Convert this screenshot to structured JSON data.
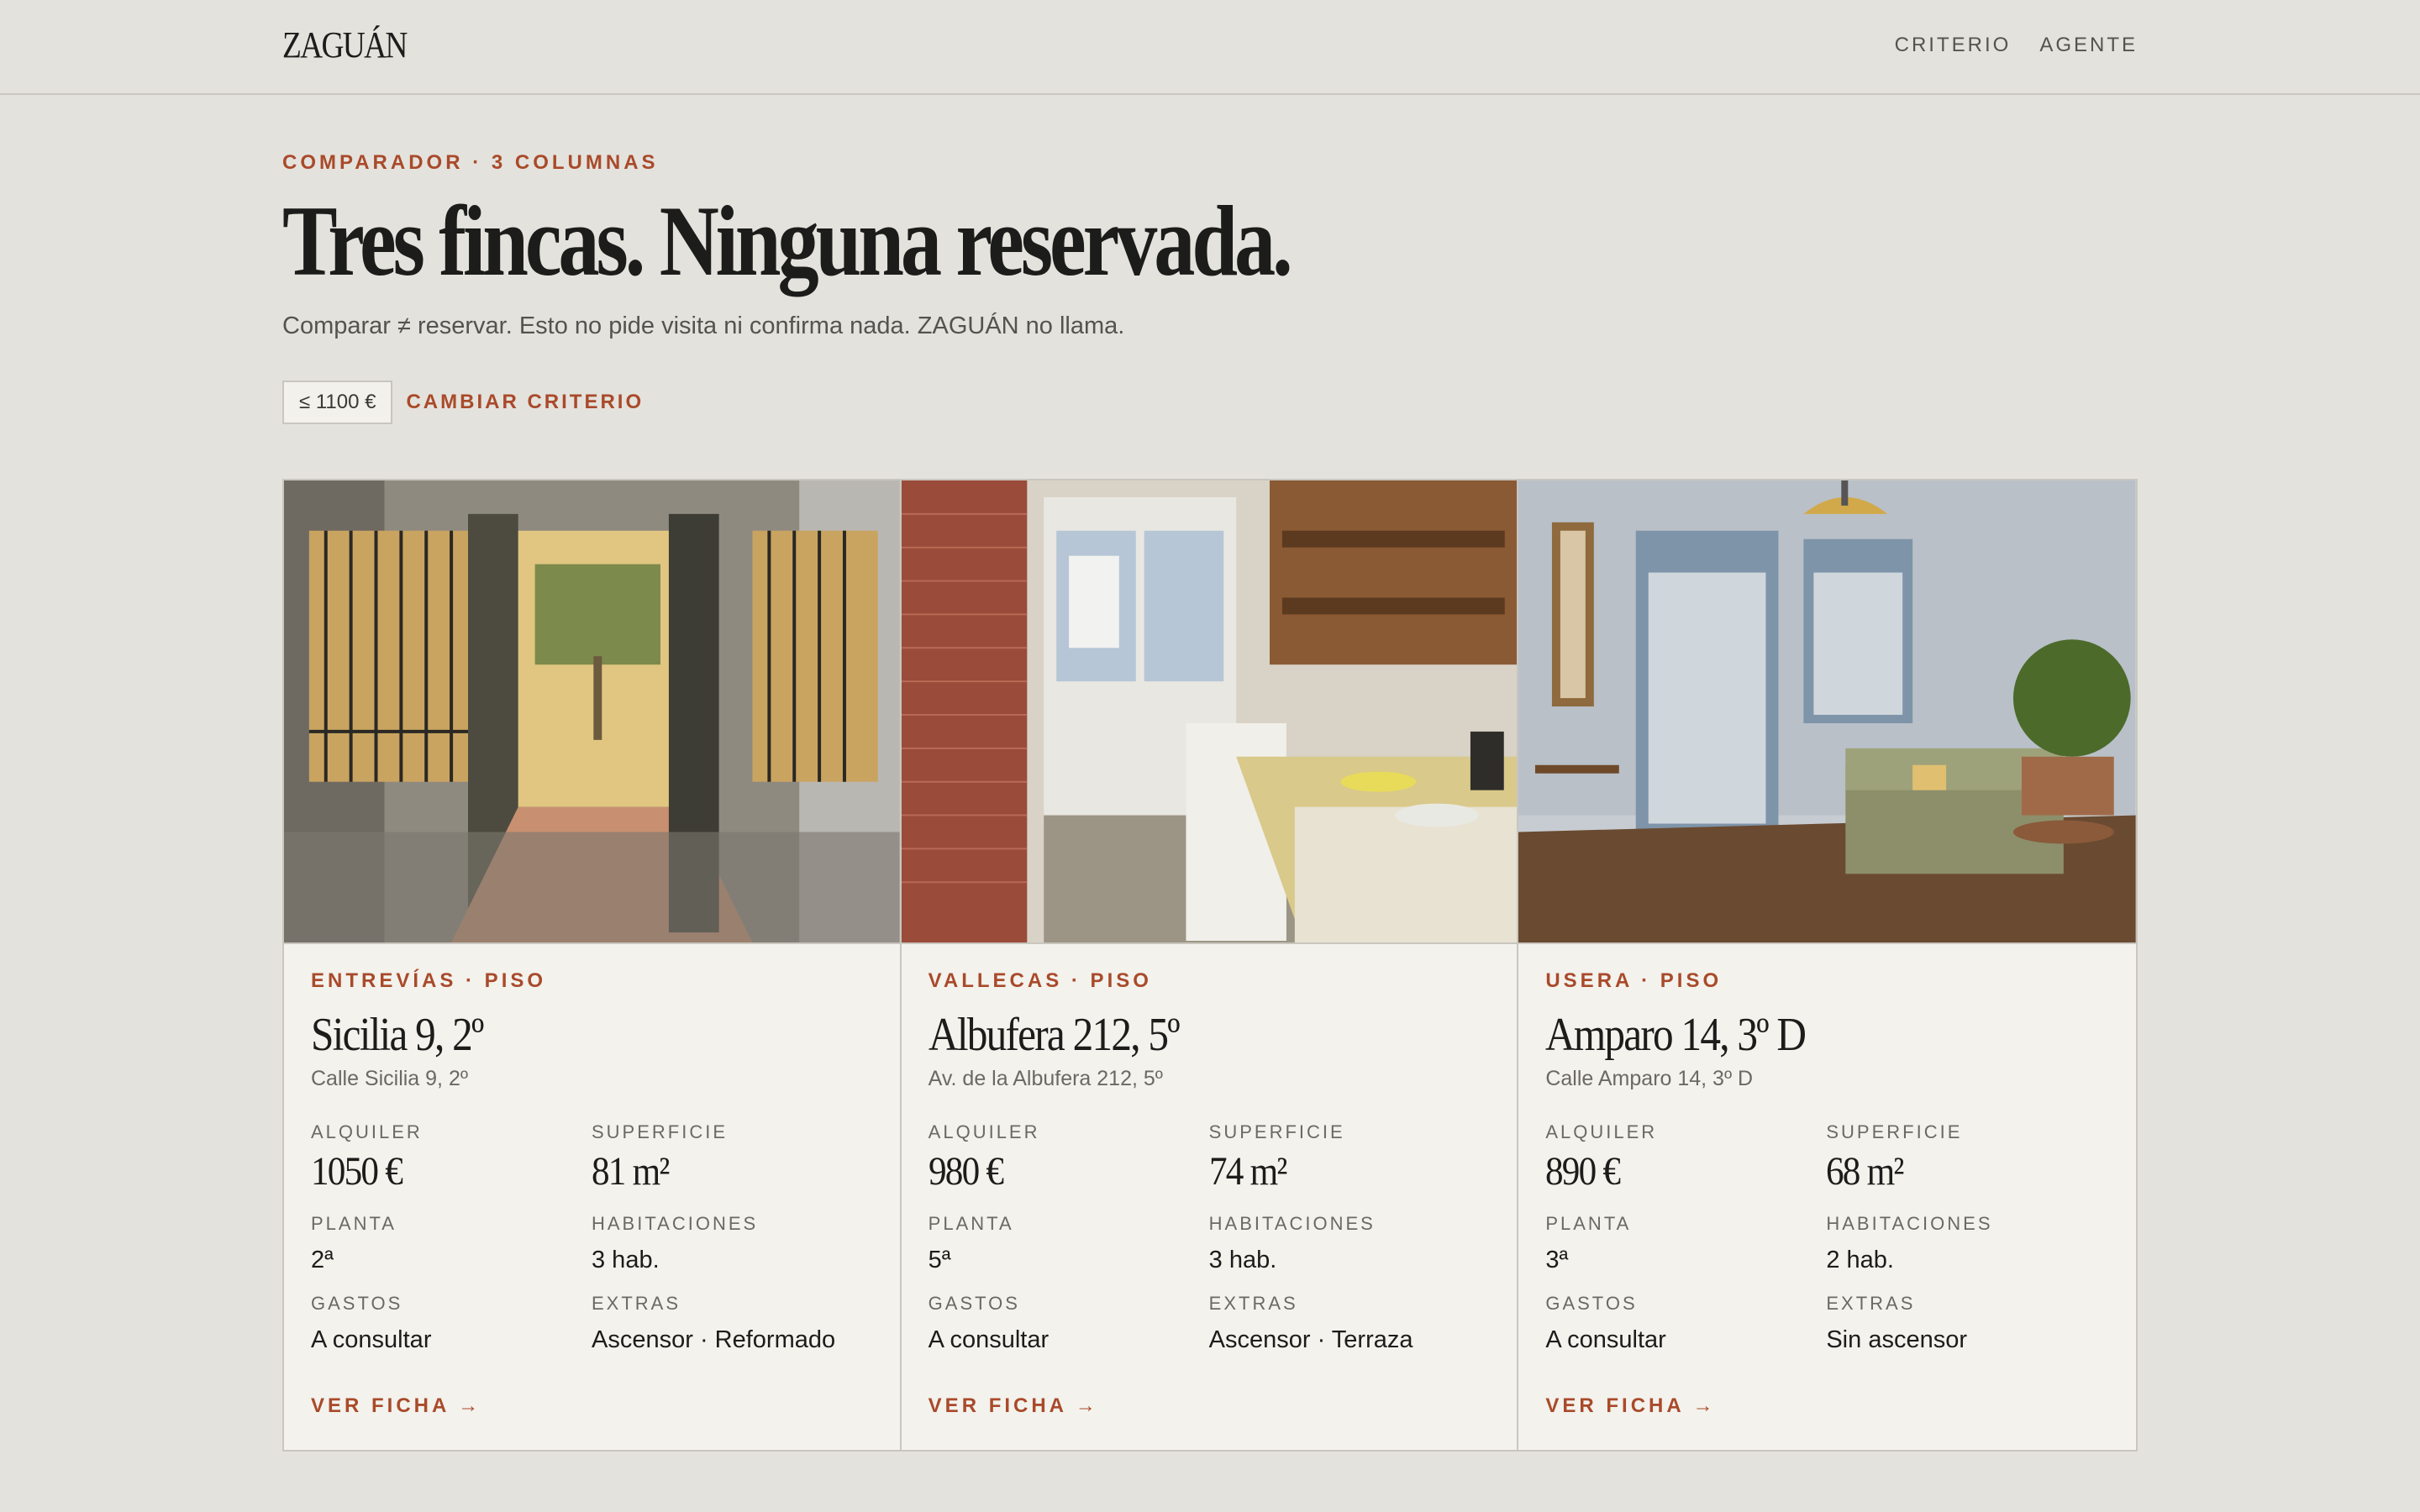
{
  "header": {
    "logo": "ZAGUÁN",
    "nav": [
      "CRITERIO",
      "AGENTE"
    ]
  },
  "hero": {
    "eyebrow": "COMPARADOR · 3 COLUMNAS",
    "title": "Tres fincas. Ninguna reservada.",
    "subtitle": "Comparar ≠ reservar. Esto no pide visita ni confirma nada. ZAGUÁN no llama.",
    "chip": "≤ 1100 €",
    "change_label": "CAMBIAR CRITERIO"
  },
  "labels": {
    "rent": "ALQUILER",
    "surface": "SUPERFICIE",
    "floor": "PLANTA",
    "rooms": "HABITACIONES",
    "fees": "GASTOS",
    "extras": "EXTRAS",
    "cta": "VER FICHA →"
  },
  "cards": [
    {
      "area": "ENTREVÍAS · PISO",
      "name": "Sicilia 9, 2º",
      "address": "Calle Sicilia 9, 2º",
      "rent": "1050 €",
      "surface": "81 m²",
      "floor": "2ª",
      "rooms": "3 hab.",
      "fees": "A consultar",
      "extras": "Ascensor · Reformado",
      "photo_icon": "courtyard-doorway-photo"
    },
    {
      "area": "VALLECAS · PISO",
      "name": "Albufera 212, 5º",
      "address": "Av. de la Albufera 212, 5º",
      "rent": "980 €",
      "surface": "74 m²",
      "floor": "5ª",
      "rooms": "3 hab.",
      "fees": "A consultar",
      "extras": "Ascensor · Terraza",
      "photo_icon": "kitchen-photo"
    },
    {
      "area": "USERA · PISO",
      "name": "Amparo 14, 3º D",
      "address": "Calle Amparo 14, 3º D",
      "rent": "890 €",
      "surface": "68 m²",
      "floor": "3ª",
      "rooms": "2 hab.",
      "fees": "A consultar",
      "extras": "Sin ascensor",
      "photo_icon": "living-room-photo"
    }
  ],
  "colors": {
    "accent": "#a94a2a",
    "background": "#e4e2dd",
    "card": "#f3f2ed"
  }
}
